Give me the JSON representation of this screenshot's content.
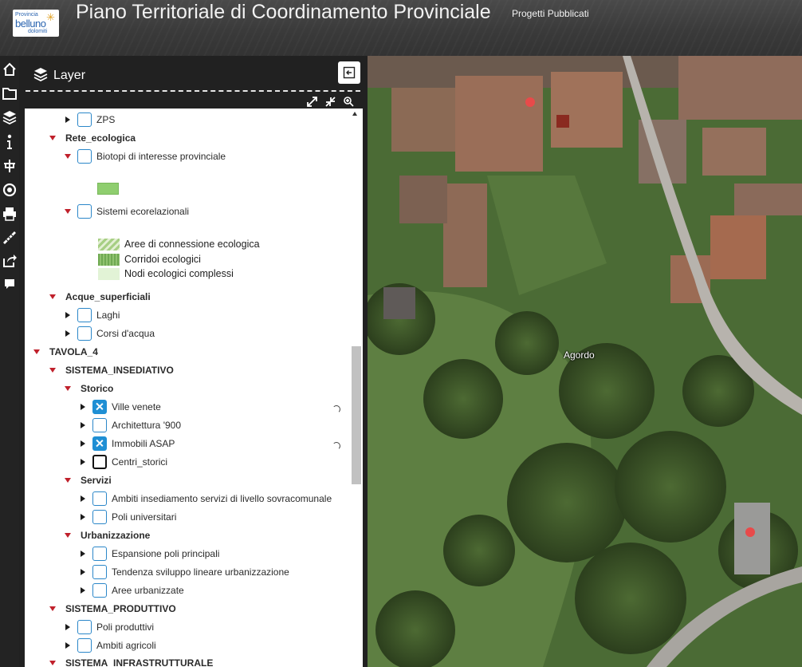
{
  "header": {
    "logo": {
      "line1": "Provincia",
      "line2": "belluno",
      "line3": "dolomiti",
      "alt": "Provincia di Belluno Dolomiti logo"
    },
    "title": "Piano Territoriale di Coordinamento Provinciale",
    "subtitle": "Progetti Pubblicati"
  },
  "toolbar": {
    "icons": [
      "home-icon",
      "folder-icon",
      "layers-icon",
      "info-icon",
      "tree-structure-icon",
      "target-icon",
      "print-icon",
      "measure-icon",
      "share-icon",
      "comment-icon"
    ]
  },
  "panel": {
    "title": "Layer",
    "tools": [
      "expand-icon",
      "collapse-all-icon",
      "zoom-icon"
    ]
  },
  "tree": {
    "zps": "ZPS",
    "rete_ecologica": "Rete_ecologica",
    "biotopi": "Biotopi di interesse provinciale",
    "sistemi_ecorelazionali": "Sistemi ecorelazionali",
    "legend": {
      "aree_connessione": "Aree di connessione ecologica",
      "corridoi": "Corridoi ecologici",
      "nodi": "Nodi ecologici complessi"
    },
    "acque_superficiali": "Acque_superficiali",
    "laghi": "Laghi",
    "corsi_acqua": "Corsi d'acqua",
    "tavola_4": "TAVOLA_4",
    "sistema_insediativo": "SISTEMA_INSEDIATIVO",
    "storico": "Storico",
    "ville_venete": "Ville venete",
    "architettura_900": "Architettura '900",
    "immobili_asap": "Immobili ASAP",
    "centri_storici": "Centri_storici",
    "servizi": "Servizi",
    "ambiti_insediamento": "Ambiti insediamento servizi di livello sovracomunale",
    "poli_universitari": "Poli universitari",
    "urbanizzazione": "Urbanizzazione",
    "espansione_poli": "Espansione poli principali",
    "tendenza_sviluppo": "Tendenza sviluppo lineare urbanizzazione",
    "aree_urbanizzate": "Aree urbanizzate",
    "sistema_produttivo": "SISTEMA_PRODUTTIVO",
    "poli_produttivi": "Poli produttivi",
    "ambiti_agricoli": "Ambiti agricoli",
    "sistema_infrastrutturale": "SISTEMA_INFRASTRUTTURALE",
    "checked_layers": [
      "Ville venete",
      "Immobili ASAP"
    ],
    "loading_layers": [
      "Ville venete",
      "Immobili ASAP"
    ]
  },
  "map": {
    "place_label": "Agordo"
  },
  "colors": {
    "accent": "#1f8fd4",
    "caret_expanded": "#c0202b",
    "biotopi_fill": "#8fce6f",
    "marker_red": "#e84a4a"
  }
}
